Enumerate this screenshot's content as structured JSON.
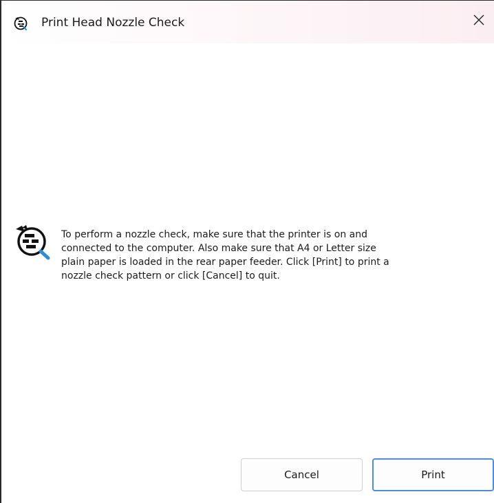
{
  "window": {
    "title": "Print Head Nozzle Check",
    "title_icon": "nozzle-check-icon",
    "close_icon": "close-icon"
  },
  "dialog": {
    "icon": "nozzle-check-icon",
    "message_lines": [
      "To perform a nozzle check, make sure that the printer is on and",
      "connected to the computer. Also make sure that A4 or Letter size",
      "plain paper is loaded in the rear paper feeder. Click [Print] to print a",
      "nozzle check pattern or click [Cancel] to quit."
    ]
  },
  "buttons": {
    "cancel_label": "Cancel",
    "print_label": "Print"
  },
  "colors": {
    "accent_border": "#4a8fd8",
    "text": "#1a1a1a"
  }
}
